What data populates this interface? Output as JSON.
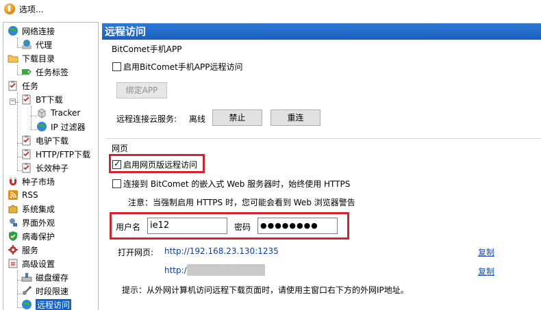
{
  "window": {
    "title": "选项..."
  },
  "sidebar": {
    "items": [
      {
        "label": "网络连接",
        "icon": "globe-network-icon"
      },
      {
        "label": "代理",
        "icon": "proxy-globe-icon"
      },
      {
        "label": "下载目录",
        "icon": "folder-icon"
      },
      {
        "label": "任务标签",
        "icon": "tag-icon"
      },
      {
        "label": "任务",
        "icon": "task-clipboard-icon"
      },
      {
        "label": "BT下载",
        "icon": "bt-clipboard-icon"
      },
      {
        "label": "Tracker",
        "icon": "tracker-cube-icon"
      },
      {
        "label": "IP 过滤器",
        "icon": "ip-filter-globe-icon"
      },
      {
        "label": "电驴下载",
        "icon": "edonkey-clipboard-icon"
      },
      {
        "label": "HTTP/FTP下载",
        "icon": "http-clipboard-icon"
      },
      {
        "label": "长效种子",
        "icon": "longterm-seed-icon"
      },
      {
        "label": "种子市场",
        "icon": "magnet-icon"
      },
      {
        "label": "RSS",
        "icon": "rss-icon"
      },
      {
        "label": "系统集成",
        "icon": "puzzle-icon"
      },
      {
        "label": "界面外观",
        "icon": "appearance-icon"
      },
      {
        "label": "病毒保护",
        "icon": "shield-icon"
      },
      {
        "label": "服务",
        "icon": "service-gear-icon"
      },
      {
        "label": "高级设置",
        "icon": "advanced-settings-icon"
      },
      {
        "label": "磁盘缓存",
        "icon": "disk-cache-icon"
      },
      {
        "label": "时段限速",
        "icon": "schedule-icon"
      },
      {
        "label": "远程访问",
        "icon": "remote-access-icon"
      }
    ],
    "selected": "远程访问"
  },
  "panel": {
    "title": "远程访问",
    "app_group": {
      "title": "BitComet手机APP",
      "enable_label": "启用BitComet手机APP远程访问",
      "enable_checked": false,
      "bind_button": "绑定APP",
      "cloud_label": "远程连接云服务:",
      "cloud_status": "离线",
      "disable_button": "禁止",
      "reconnect_button": "重连"
    },
    "web_group": {
      "title": "网页",
      "enable_label": "启用网页版远程访问",
      "enable_checked": true,
      "https_label": "连接到 BitComet 的嵌入式 Web 服务器时，始终使用 HTTPS",
      "https_checked": false,
      "https_note": "注意：当强制启用 HTTPS 时，您可能会看到 Web 浏览器警告",
      "username_label": "用户名",
      "username_value": "ie12",
      "password_label": "密码",
      "password_value": "●●●●●●●●",
      "open_label": "打开网页:",
      "url_local": "http://192.168.23.130:1235",
      "url_public": "http://",
      "copy_label_1": "复制",
      "copy_label_2": "复制",
      "hint": "提示：从外网计算机访问远程下载页面时，请使用主窗口右下方的外网IP地址。"
    }
  },
  "colors": {
    "header_blue": "#1c5fbf",
    "selection_blue": "#0a64d8",
    "highlight_red": "#d3232d",
    "link_blue": "#0a3ea8"
  }
}
